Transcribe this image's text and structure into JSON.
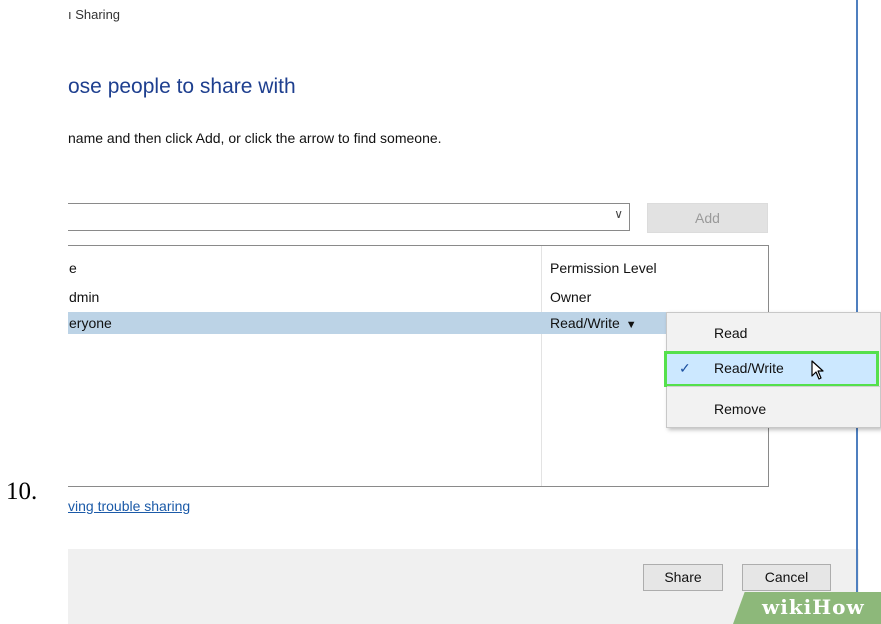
{
  "step_number": "10.",
  "window": {
    "title": "File Sharing",
    "title_visible": "ı Sharing",
    "heading": "ose people to share with",
    "instruction": "name and then click Add, or click the arrow to find someone."
  },
  "name_input": {
    "value": "",
    "arrow_icon": "chevron-down-icon"
  },
  "add_button": {
    "label": "Add",
    "enabled": false
  },
  "table": {
    "headers": {
      "name": "e",
      "permission": "Permission Level"
    },
    "rows": [
      {
        "name": "dmin",
        "permission": "Owner"
      },
      {
        "name": "eryone",
        "permission": "Read/Write",
        "selected": true
      }
    ]
  },
  "permission_menu": {
    "items": [
      {
        "label": "Read",
        "checked": false
      },
      {
        "label": "Read/Write",
        "checked": true,
        "highlighted": true
      },
      {
        "label": "Remove",
        "checked": false
      }
    ],
    "check_icon": "checkmark-icon",
    "cursor_icon": "mouse-pointer-icon"
  },
  "help_link": "ving trouble sharing",
  "footer": {
    "share_label": "Share",
    "cancel_label": "Cancel"
  },
  "watermark": "wikiHow",
  "colors": {
    "heading": "#1e3f8f",
    "selected_row": "#bcd3e6",
    "highlight_border": "#55e04c",
    "menu_hover": "#cce8ff",
    "link": "#1b5aa8"
  }
}
